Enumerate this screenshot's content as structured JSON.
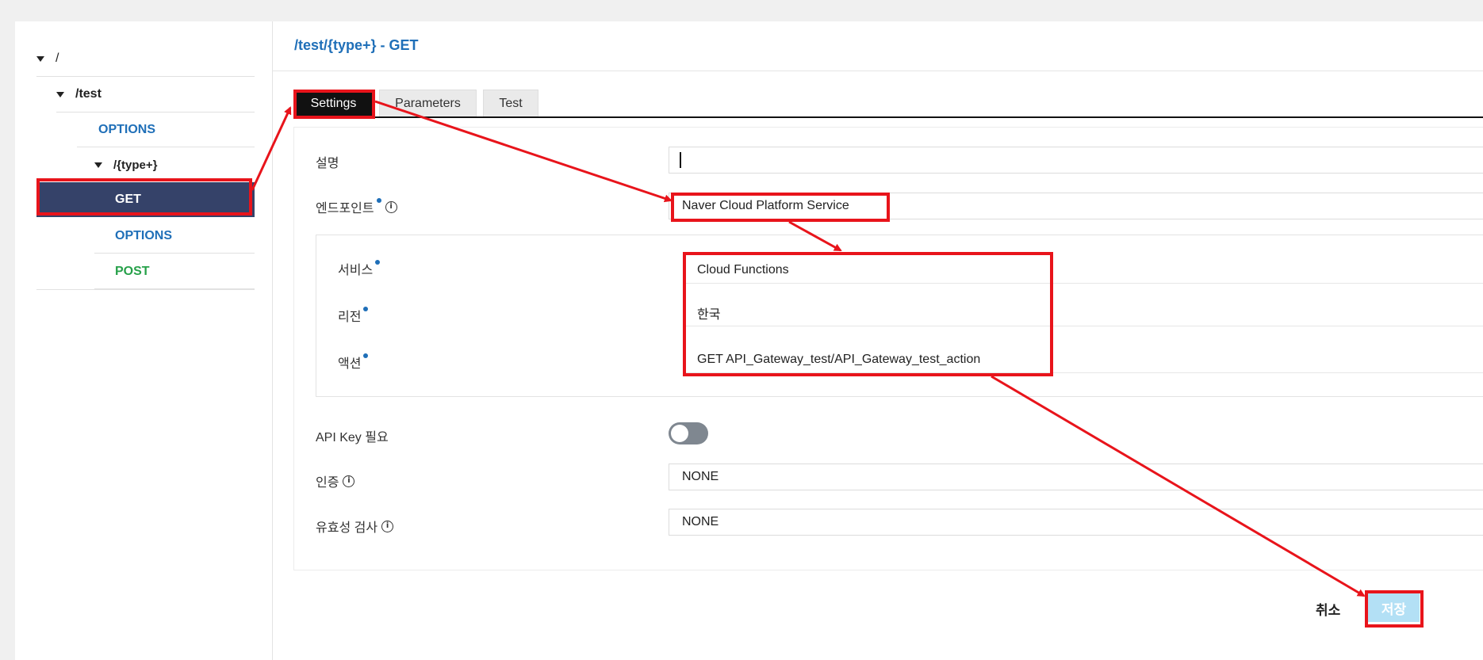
{
  "tree": {
    "root": "/",
    "test": "/test",
    "test_options": "OPTIONS",
    "type_plus": "/{type+}",
    "get": "GET",
    "type_options": "OPTIONS",
    "post": "POST"
  },
  "header": {
    "title": "/test/{type+} - GET"
  },
  "tabs": [
    {
      "label": "Settings",
      "active": true
    },
    {
      "label": "Parameters",
      "active": false
    },
    {
      "label": "Test",
      "active": false
    }
  ],
  "form": {
    "description_label": "설명",
    "description_value": "",
    "endpoint_label": "엔드포인트",
    "endpoint_value": "Naver Cloud Platform Service",
    "service_label": "서비스",
    "service_value": "Cloud Functions",
    "region_label": "리전",
    "region_value": "한국",
    "action_label": "액션",
    "action_value": "GET API_Gateway_test/API_Gateway_test_action",
    "api_key_label": "API Key 필요",
    "api_key_required": false,
    "auth_label": "인증",
    "auth_value": "NONE",
    "validation_label": "유효성 검사",
    "validation_value": "NONE"
  },
  "actions": {
    "cancel_label": "취소",
    "save_label": "저장"
  },
  "colors": {
    "accent": "#1f6fb8",
    "selected_row": "#354269",
    "post_method": "#27a14a",
    "annotation": "#e8141b",
    "save_button": "#b3e0f5"
  }
}
